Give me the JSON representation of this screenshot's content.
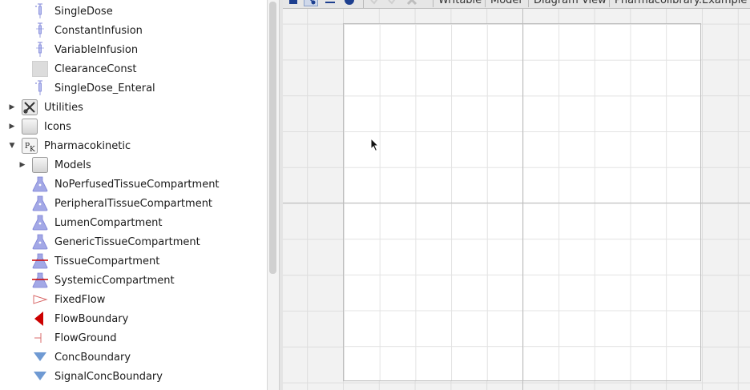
{
  "tree": {
    "items": [
      {
        "label": "SingleDose",
        "icon": "syringe-icon",
        "indent": 2,
        "expander": "none"
      },
      {
        "label": "ConstantInfusion",
        "icon": "infusion-icon",
        "indent": 2,
        "expander": "none"
      },
      {
        "label": "VariableInfusion",
        "icon": "infusion-icon",
        "indent": 2,
        "expander": "none"
      },
      {
        "label": "ClearanceConst",
        "icon": "blank-square-icon",
        "indent": 2,
        "expander": "none"
      },
      {
        "label": "SingleDose_Enteral",
        "icon": "syringe-icon",
        "indent": 2,
        "expander": "none"
      },
      {
        "label": "Utilities",
        "icon": "tools-icon",
        "indent": 1,
        "expander": "collapsed"
      },
      {
        "label": "Icons",
        "icon": "folder-box-icon",
        "indent": 1,
        "expander": "collapsed"
      },
      {
        "label": "Pharmacokinetic",
        "icon": "pk-icon",
        "indent": 1,
        "expander": "expanded"
      },
      {
        "label": "Models",
        "icon": "folder-box-icon",
        "indent": 2,
        "expander": "collapsed"
      },
      {
        "label": "NoPerfusedTissueCompartment",
        "icon": "flask-icon",
        "indent": 2,
        "expander": "none"
      },
      {
        "label": "PeripheralTissueCompartment",
        "icon": "flask-icon",
        "indent": 2,
        "expander": "none"
      },
      {
        "label": "LumenCompartment",
        "icon": "flask-icon",
        "indent": 2,
        "expander": "none"
      },
      {
        "label": "GenericTissueCompartment",
        "icon": "flask-icon",
        "indent": 2,
        "expander": "none"
      },
      {
        "label": "TissueCompartment",
        "icon": "flask-redline-icon",
        "indent": 2,
        "expander": "none"
      },
      {
        "label": "SystemicCompartment",
        "icon": "flask-redline-icon",
        "indent": 2,
        "expander": "none"
      },
      {
        "label": "FixedFlow",
        "icon": "outline-triangle-icon",
        "indent": 2,
        "expander": "none"
      },
      {
        "label": "FlowBoundary",
        "icon": "red-triangle-icon",
        "indent": 2,
        "expander": "none"
      },
      {
        "label": "FlowGround",
        "icon": "flow-ground-icon",
        "indent": 2,
        "expander": "none"
      },
      {
        "label": "ConcBoundary",
        "icon": "blue-down-triangle-icon",
        "indent": 2,
        "expander": "none"
      },
      {
        "label": "SignalConcBoundary",
        "icon": "blue-down-triangle-icon",
        "indent": 2,
        "expander": "none"
      }
    ]
  },
  "toolbar": {
    "tabs": [
      "Writable",
      "Model",
      "Diagram View",
      "Pharmacolibrary.Example"
    ]
  },
  "colors": {
    "flask": "#a3a8e6",
    "red": "#cc0000",
    "blue": "#6f9ad3"
  }
}
